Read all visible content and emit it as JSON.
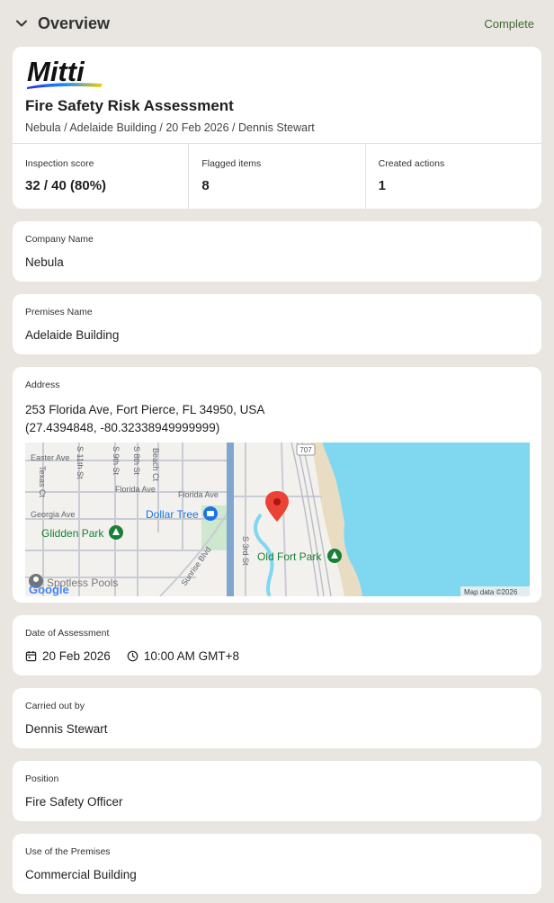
{
  "header": {
    "title": "Overview",
    "status": "Complete"
  },
  "report": {
    "logo_text": "Mitti",
    "title": "Fire Safety Risk Assessment",
    "subtitle": "Nebula / Adelaide Building / 20 Feb 2026 / Dennis Stewart",
    "stats": [
      {
        "label": "Inspection score",
        "value": "32 / 40 (80%)"
      },
      {
        "label": "Flagged items",
        "value": "8"
      },
      {
        "label": "Created actions",
        "value": "1"
      }
    ]
  },
  "company": {
    "label": "Company Name",
    "value": "Nebula"
  },
  "premises": {
    "label": "Premises Name",
    "value": "Adelaide Building"
  },
  "address": {
    "label": "Address",
    "line1": "253 Florida Ave, Fort Pierce, FL 34950, USA",
    "line2": "(27.4394848, -80.32338949999999)",
    "map": {
      "streets": [
        "Easter Ave",
        "S 11th St",
        "S 9th St",
        "S 8th St",
        "Beach Ct",
        "Texas Ct",
        "Florida Ave",
        "Florida Ave",
        "Georgia Ave",
        "Sunrise Blvd",
        "S 3rd St"
      ],
      "places": [
        "Dollar Tree",
        "Glidden Park",
        "Old Fort Park",
        "Spotless Pools"
      ],
      "road_badge": "707",
      "google": "Google",
      "attribution": "Map data ©2026"
    }
  },
  "date": {
    "label": "Date of Assessment",
    "date": "20 Feb 2026",
    "time": "10:00 AM GMT+8"
  },
  "carried_out": {
    "label": "Carried out by",
    "value": "Dennis Stewart"
  },
  "position": {
    "label": "Position",
    "value": "Fire Safety Officer"
  },
  "use": {
    "label": "Use of the Premises",
    "value": "Commercial Building"
  }
}
